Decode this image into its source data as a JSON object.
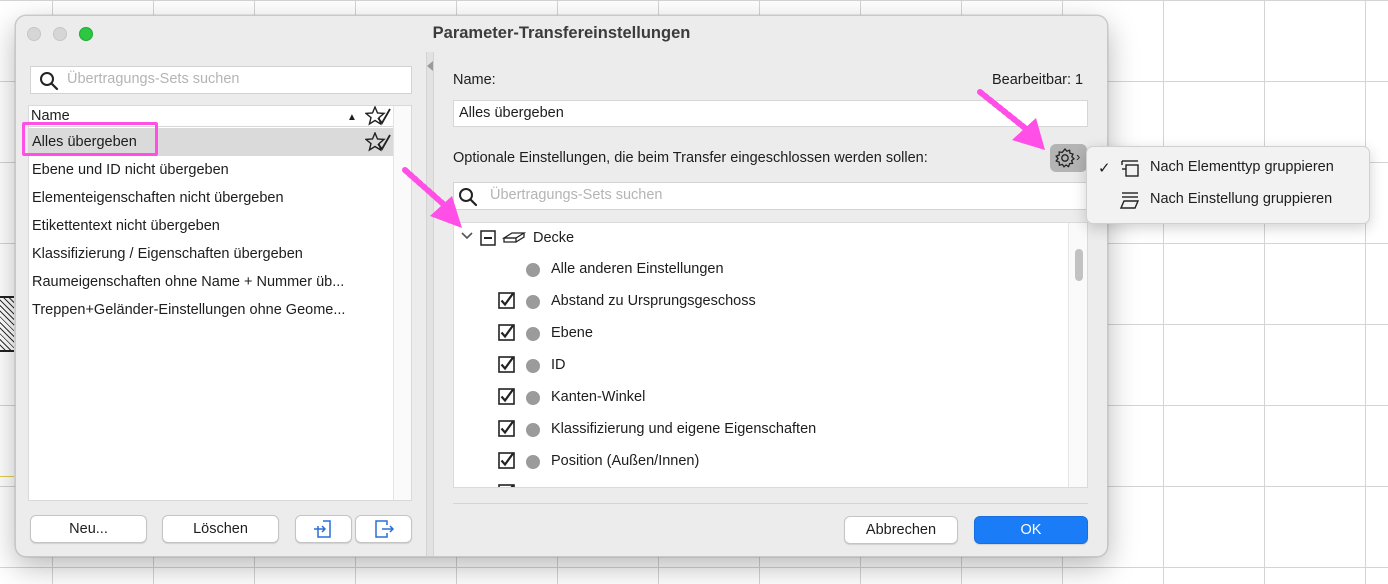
{
  "window": {
    "title": "Parameter-Transfereinstellungen"
  },
  "left": {
    "search_placeholder": "Übertragungs-Sets suchen",
    "column_name": "Name",
    "sort_indicator": "▲",
    "items": [
      {
        "label": "Alles übergeben",
        "selected": true
      },
      {
        "label": "Ebene und ID nicht übergeben"
      },
      {
        "label": "Elementeigenschaften nicht übergeben"
      },
      {
        "label": "Etikettentext nicht übergeben"
      },
      {
        "label": "Klassifizierung / Eigenschaften übergeben"
      },
      {
        "label": "Raumeigenschaften ohne Name + Nummer üb..."
      },
      {
        "label": "Treppen+Geländer-Einstellungen ohne Geome..."
      }
    ],
    "new_button": "Neu...",
    "delete_button": "Löschen"
  },
  "right": {
    "name_label": "Name:",
    "editable_label": "Bearbeitbar: 1",
    "name_value": "Alles übergeben",
    "optional_label": "Optionale Einstellungen, die beim Transfer eingeschlossen werden sollen:",
    "search_placeholder": "Übertragungs-Sets suchen",
    "tree_root": "Decke",
    "tree_items": [
      {
        "label": "Alle anderen Einstellungen",
        "checkbox": false
      },
      {
        "label": "Abstand zu Ursprungsgeschoss",
        "checkbox": true
      },
      {
        "label": "Ebene",
        "checkbox": true
      },
      {
        "label": "ID",
        "checkbox": true
      },
      {
        "label": "Kanten-Winkel",
        "checkbox": true
      },
      {
        "label": "Klassifizierung und eigene Eigenschaften",
        "checkbox": true
      },
      {
        "label": "Position (Außen/Innen)",
        "checkbox": true
      }
    ],
    "cancel_button": "Abbrechen",
    "ok_button": "OK"
  },
  "menu": {
    "items": [
      {
        "label": "Nach Elementtyp gruppieren",
        "checked": true,
        "icon": "element-type-group-icon"
      },
      {
        "label": "Nach Einstellung gruppieren",
        "checked": false,
        "icon": "setting-group-icon"
      }
    ],
    "checkmark": "✓"
  },
  "colors": {
    "accent": "#1a7cf7",
    "annotation": "#ff4fe6"
  }
}
